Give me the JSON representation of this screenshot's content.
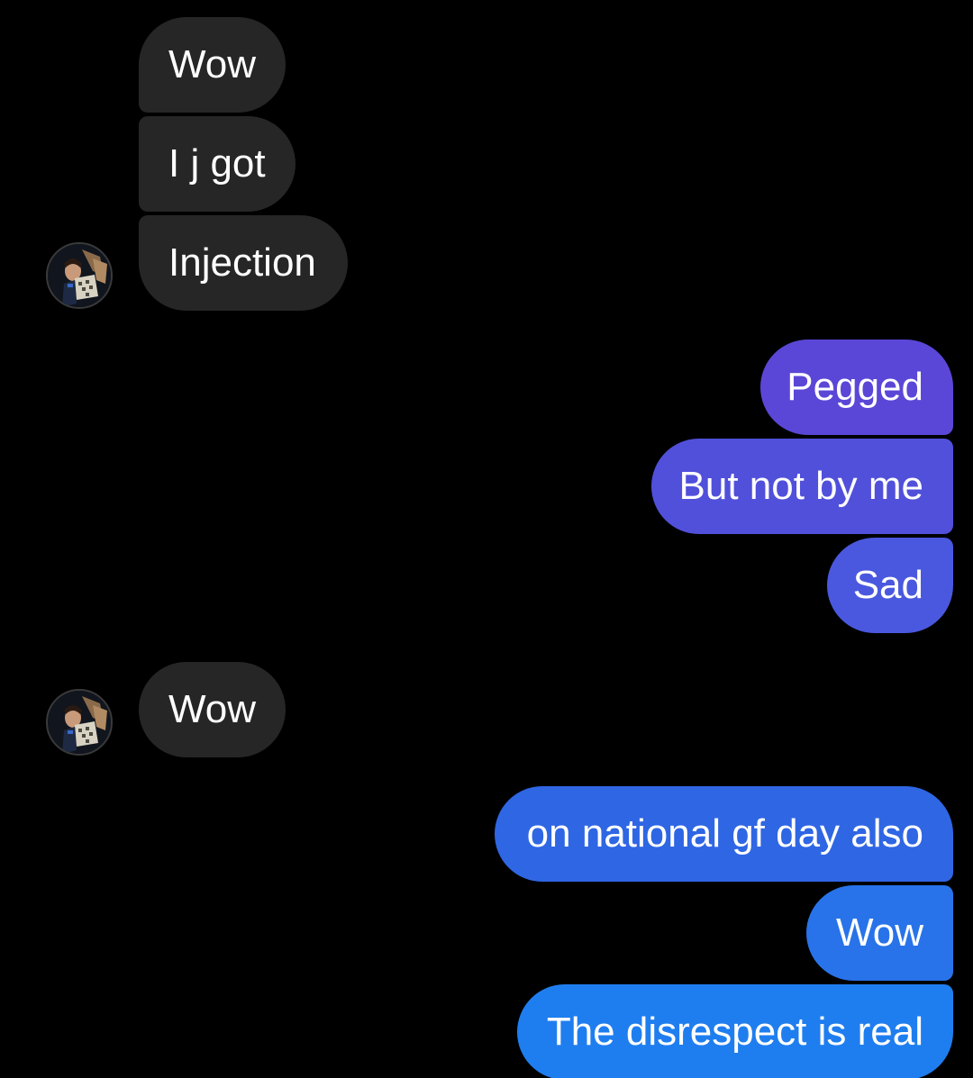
{
  "colors": {
    "background": "#000000",
    "incoming_bubble": "#262626",
    "outgoing_gradient_top": "#5a46d8",
    "outgoing_gradient_bottom": "#1e7ff0",
    "text": "#ffffff"
  },
  "contact": {
    "avatar_icon": "profile-photo"
  },
  "groups": [
    {
      "sender": "contact",
      "messages": [
        {
          "text": "Wow"
        },
        {
          "text": "I j got"
        },
        {
          "text": "Injection"
        }
      ]
    },
    {
      "sender": "me",
      "messages": [
        {
          "text": "Pegged"
        },
        {
          "text": "But not by me"
        },
        {
          "text": "Sad"
        }
      ]
    },
    {
      "sender": "contact",
      "messages": [
        {
          "text": "Wow"
        }
      ]
    },
    {
      "sender": "me",
      "messages": [
        {
          "text": "on national gf day also"
        },
        {
          "text": "Wow"
        },
        {
          "text": "The disrespect is real"
        }
      ]
    }
  ]
}
